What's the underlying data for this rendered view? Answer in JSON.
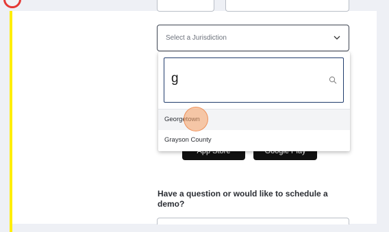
{
  "jurisdiction_select": {
    "placeholder": "Select a Jurisdiction"
  },
  "dropdown": {
    "search_value": "g",
    "options": [
      {
        "label": "Georgetown"
      },
      {
        "label": "Grayson County"
      }
    ]
  },
  "app_buttons": {
    "apple_label": "App Store",
    "google_label": "Google Play"
  },
  "contact": {
    "heading": "Have a question or would like to schedule a demo?"
  },
  "colors": {
    "guide_bar": "#ffee00",
    "badge_ring": "#e53935",
    "click_marker": "#f5a064",
    "search_border": "#1f3a6b"
  },
  "icons": {
    "select_indicator": "chevron-down-icon",
    "search": "search-icon"
  }
}
